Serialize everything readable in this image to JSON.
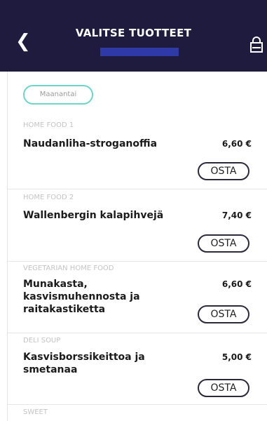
{
  "header": {
    "title": "VALITSE TUOTTEET",
    "back_icon": "chevron-left-icon",
    "bag_icon": "shopping-bag-icon",
    "bg_color": "#1e1b3f"
  },
  "filter": {
    "day_label": "Maanantai",
    "chip_color": "#6dd5c8"
  },
  "items": [
    {
      "category": "HOME FOOD 1",
      "name": "Naudanliha-stroganoffia",
      "price": "6,60 €",
      "buy_label": "OSTA"
    },
    {
      "category": "HOME FOOD 2",
      "name": "Wallenbergin kalapihvejä",
      "price": "7,40 €",
      "buy_label": "OSTA"
    },
    {
      "category": "VEGETARIAN HOME FOOD",
      "name": "Munakasta, kasvismuhennosta ja raitakastiketta",
      "price": "6,60 €",
      "buy_label": "OSTA"
    },
    {
      "category": "DELI SOUP",
      "name": "Kasvisborssikeittoa ja smetanaa",
      "price": "5,00 €",
      "buy_label": "OSTA"
    },
    {
      "category": "SWEET"
    }
  ]
}
